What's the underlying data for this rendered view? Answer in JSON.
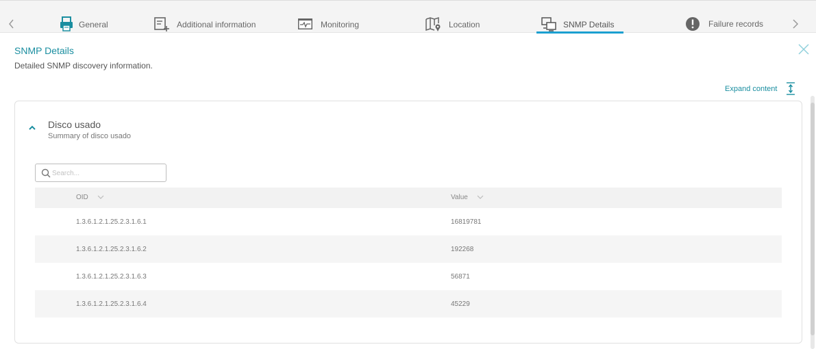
{
  "tabs": [
    {
      "label": "General",
      "icon": "printer-icon",
      "active": false
    },
    {
      "label": "Additional information",
      "icon": "add-info-icon",
      "active": false
    },
    {
      "label": "Monitoring",
      "icon": "monitoring-icon",
      "active": false
    },
    {
      "label": "Location",
      "icon": "map-pin-icon",
      "active": false
    },
    {
      "label": "SNMP Details",
      "icon": "network-icon",
      "active": true
    },
    {
      "label": "Failure records",
      "icon": "exclamation-icon",
      "active": false
    }
  ],
  "header": {
    "title": "SNMP Details",
    "subtitle": "Detailed SNMP discovery information."
  },
  "expand_label": "Expand content",
  "section": {
    "title": "Disco usado",
    "subtitle": "Summary of disco usado"
  },
  "search": {
    "placeholder": "Search..."
  },
  "table": {
    "columns": [
      "OID",
      "Value"
    ],
    "rows": [
      {
        "oid": "1.3.6.1.2.1.25.2.3.1.6.1",
        "value": "16819781"
      },
      {
        "oid": "1.3.6.1.2.1.25.2.3.1.6.2",
        "value": "192268"
      },
      {
        "oid": "1.3.6.1.2.1.25.2.3.1.6.3",
        "value": "56871"
      },
      {
        "oid": "1.3.6.1.2.1.25.2.3.1.6.4",
        "value": "45229"
      }
    ]
  },
  "colors": {
    "accent": "#1a8ea0",
    "tab_underline": "#1a9fd0"
  }
}
